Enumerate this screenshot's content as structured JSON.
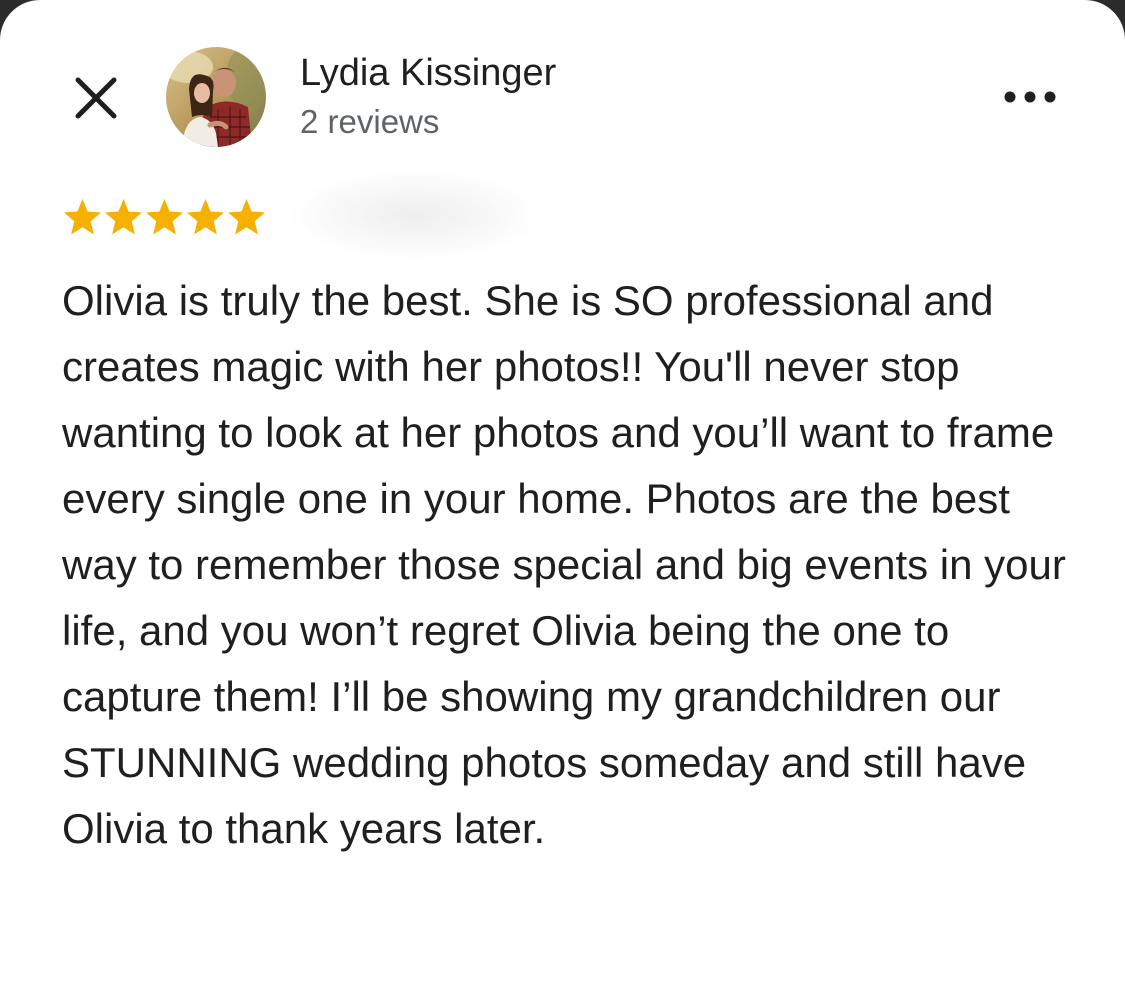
{
  "review": {
    "author_name": "Lydia Kissinger",
    "review_count_label": "2 reviews",
    "rating": 5,
    "rating_max": 5,
    "star_color": "#F6B100",
    "text": "Olivia is truly the best. She is SO professional and creates magic with her photos!! You'll never stop wanting to look at her photos and you’ll want to frame every single one in your home. Photos are the best way to remember those special and big events in your life, and you won’t regret Olivia being the one to capture them! I’ll be showing my grandchildren our STUNNING wedding photos someday and still have Olivia to thank years later."
  },
  "toolbar": {
    "close_icon": "close-icon",
    "more_icon": "more-horizontal-icon"
  }
}
